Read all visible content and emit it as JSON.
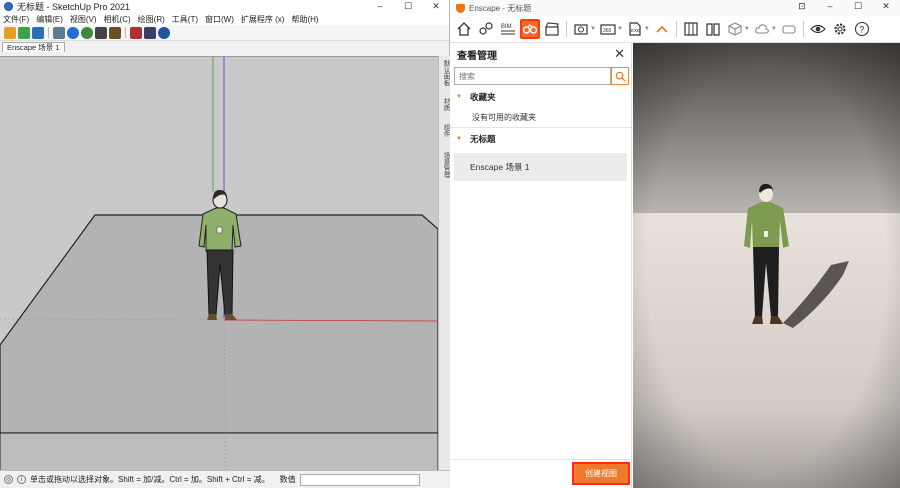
{
  "sketchup": {
    "title": "无标题 - SketchUp Pro 2021",
    "window_controls": [
      "–",
      "☐",
      "✕"
    ],
    "menu": [
      "文件(F)",
      "编辑(E)",
      "视图(V)",
      "相机(C)",
      "绘图(R)",
      "工具(T)",
      "窗口(W)",
      "扩展程序 (x)",
      "帮助(H)"
    ],
    "scene_tab": "Enscape 场景 1",
    "tray_items": [
      "默认面板",
      "材质",
      "组件",
      "场景管理"
    ],
    "status_text": "单击或拖动以选择对象。Shift = 加/减。Ctrl = 加。Shift + Ctrl = 减。",
    "measurements_label": "数值",
    "toolbar_icon_colors": [
      "#e8a020",
      "#3da34a",
      "#2c6fb6",
      "#5c7c8a",
      "#1e6fd0",
      "#3a8a3a",
      "#444444",
      "#6b4f2a",
      "#b03030",
      "#3c3c6a",
      "#225599"
    ]
  },
  "enscape": {
    "title": "Enscape - 无标题",
    "window_controls": [
      "⊡",
      "–",
      "☐",
      "✕"
    ],
    "toolbar": {
      "home_icon": "home-icon",
      "bim_label": "BIM",
      "active_button": "view-management",
      "accent": "#f07a2c"
    },
    "view_manager": {
      "title": "查看管理",
      "search_placeholder": "搜索",
      "favorites_label": "收藏夹",
      "favorites_empty": "没有可用的收藏夹",
      "group_label": "无标题",
      "views": [
        "Enscape 场景 1"
      ],
      "create_button": "创建视图"
    }
  }
}
